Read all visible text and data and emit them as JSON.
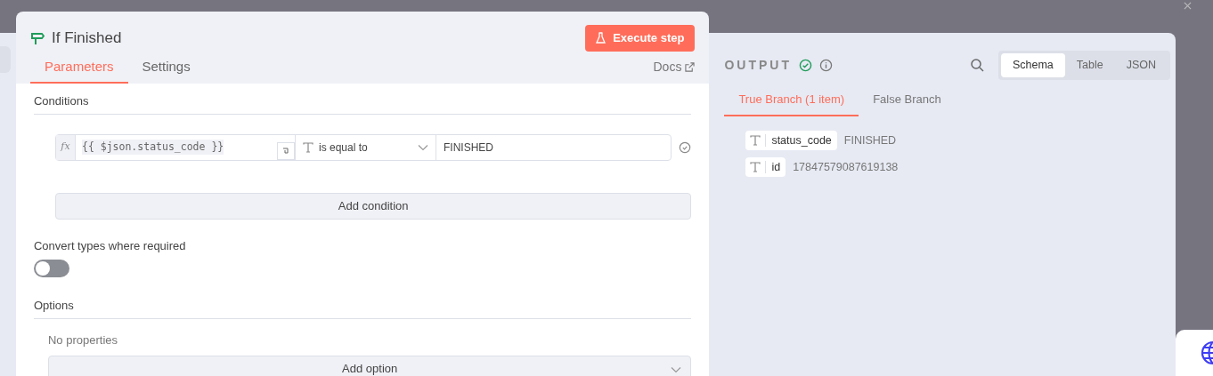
{
  "node": {
    "title": "If Finished",
    "execute_button": "Execute step",
    "docs_link": "Docs",
    "tabs": [
      {
        "label": "Parameters",
        "selected": true
      },
      {
        "label": "Settings",
        "selected": false
      }
    ],
    "conditions": {
      "heading": "Conditions",
      "add_button": "Add condition",
      "rows": [
        {
          "expression_label": "fx",
          "left_value": "{{ $json.status_code }}",
          "operator": "is equal to",
          "right_value": "FINISHED"
        }
      ]
    },
    "convert_types": {
      "label": "Convert types where required",
      "on": false
    },
    "options": {
      "heading": "Options",
      "empty_text": "No properties",
      "add_button": "Add option"
    }
  },
  "output": {
    "title": "OUTPUT",
    "view_modes": [
      {
        "label": "Schema",
        "selected": true
      },
      {
        "label": "Table",
        "selected": false
      },
      {
        "label": "JSON",
        "selected": false
      }
    ],
    "branches": [
      {
        "label": "True Branch (1 item)",
        "selected": true
      },
      {
        "label": "False Branch",
        "selected": false
      }
    ],
    "fields": [
      {
        "name": "status_code",
        "value": "FINISHED"
      },
      {
        "name": "id",
        "value": "17847579087619138"
      }
    ]
  }
}
